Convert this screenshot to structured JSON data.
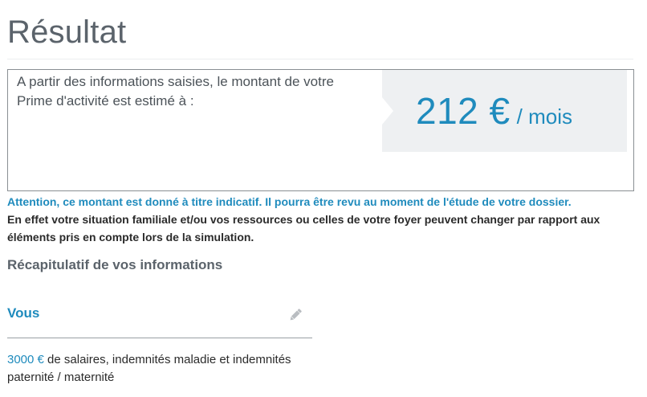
{
  "header": {
    "title": "Résultat"
  },
  "result": {
    "text": "A partir des informations saisies, le montant de votre Prime d'activité est estimé à :",
    "amount": "212 €",
    "unit": "/ mois"
  },
  "notice": {
    "warning": "Attention, ce montant est donné à titre indicatif. Il pourra être revu au moment de l'étude de votre dossier.",
    "explanation": "En effet votre situation familiale et/ou vos ressources ou celles de votre foyer peuvent changer par rapport aux éléments pris en compte lors de la simulation."
  },
  "recap": {
    "title": "Récapitulatif de vos informations",
    "section_label": "Vous",
    "edit_icon": "pencil-icon",
    "salary_amount": "3000 €",
    "salary_text": " de salaires, indemnités maladie et indemnités paternité / maternité"
  },
  "colors": {
    "accent": "#1f8bbd",
    "heading": "#5b636b",
    "panel": "#eef0f2"
  }
}
